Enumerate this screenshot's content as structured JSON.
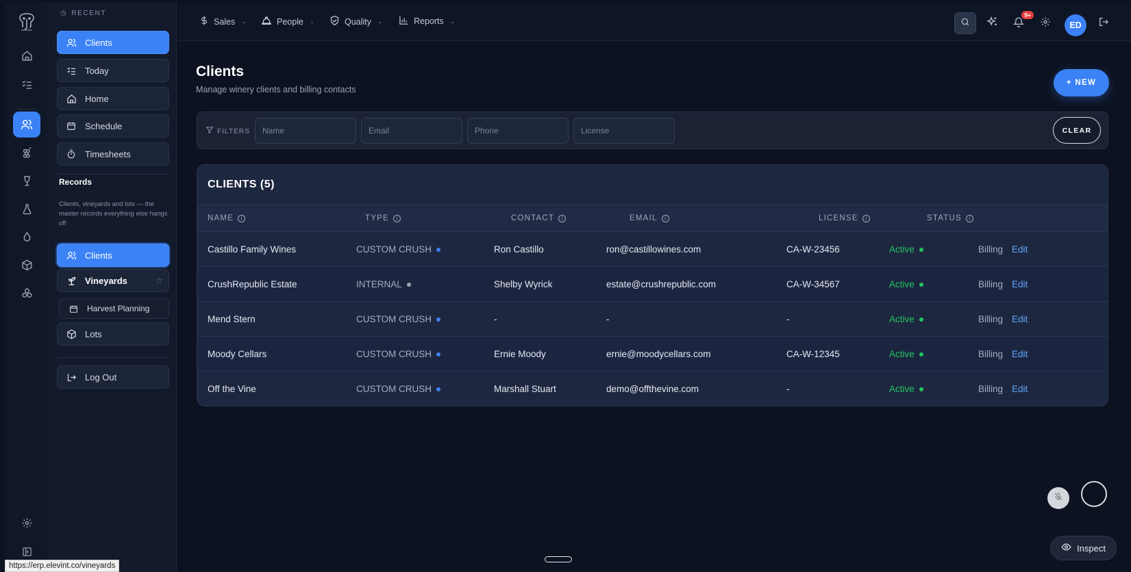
{
  "sidebar": {
    "recent_label": "RECENT",
    "recent_items": [
      {
        "label": "Clients",
        "icon": "users-icon"
      },
      {
        "label": "Today",
        "icon": "checklist-icon"
      },
      {
        "label": "Home",
        "icon": "home-icon"
      },
      {
        "label": "Schedule",
        "icon": "calendar-icon"
      },
      {
        "label": "Timesheets",
        "icon": "stopwatch-icon"
      }
    ],
    "section_title": "Records",
    "section_desc": "Clients, vineyards and lots — the master records everything else hangs off",
    "record_items": [
      {
        "label": "Clients"
      },
      {
        "label": "Vineyards"
      },
      {
        "label": "Harvest Planning"
      },
      {
        "label": "Lots"
      }
    ],
    "logout_label": "Log Out"
  },
  "topnav": [
    {
      "label": "Sales",
      "icon": "dollar-icon"
    },
    {
      "label": "People",
      "icon": "hardhat-icon"
    },
    {
      "label": "Quality",
      "icon": "shield-check-icon"
    },
    {
      "label": "Reports",
      "icon": "bar-chart-icon"
    }
  ],
  "notifications_badge": "9+",
  "avatar_initials": "ED",
  "page": {
    "title": "Clients",
    "subtitle": "Manage winery clients and billing contacts",
    "new_label": "+ NEW"
  },
  "filters": {
    "label": "FILTERS",
    "name_placeholder": "Name",
    "email_placeholder": "Email",
    "phone_placeholder": "Phone",
    "license_placeholder": "License",
    "clear_label": "CLEAR"
  },
  "table": {
    "title": "CLIENTS (5)",
    "columns": [
      "NAME",
      "TYPE",
      "CONTACT",
      "EMAIL",
      "LICENSE",
      "STATUS"
    ],
    "rows": [
      {
        "name": "Castillo Family Wines",
        "type": "CUSTOM CRUSH",
        "type_color": "#3b82f6",
        "contact": "Ron Castillo",
        "email": "ron@castillowines.com",
        "license": "CA-W-23456",
        "status": "Active",
        "billing": "Billing",
        "edit": "Edit"
      },
      {
        "name": "CrushRepublic Estate",
        "type": "INTERNAL",
        "type_color": "#9ca3af",
        "contact": "Shelby Wyrick",
        "email": "estate@crushrepublic.com",
        "license": "CA-W-34567",
        "status": "Active",
        "billing": "Billing",
        "edit": "Edit"
      },
      {
        "name": "Mend Stern",
        "type": "CUSTOM CRUSH",
        "type_color": "#3b82f6",
        "contact": "-",
        "email": "-",
        "license": "-",
        "status": "Active",
        "billing": "Billing",
        "edit": "Edit"
      },
      {
        "name": "Moody Cellars",
        "type": "CUSTOM CRUSH",
        "type_color": "#3b82f6",
        "contact": "Ernie Moody",
        "email": "ernie@moodycellars.com",
        "license": "CA-W-12345",
        "status": "Active",
        "billing": "Billing",
        "edit": "Edit"
      },
      {
        "name": "Off the Vine",
        "type": "CUSTOM CRUSH",
        "type_color": "#3b82f6",
        "contact": "Marshall Stuart",
        "email": "demo@offthevine.com",
        "license": "-",
        "status": "Active",
        "billing": "Billing",
        "edit": "Edit"
      }
    ]
  },
  "inspect_label": "Inspect",
  "status_url": "https://erp.elevint.co/vineyards",
  "colors": {
    "accent": "#3b82f6",
    "active_status": "#22c55e",
    "edit_link": "#60a5fa"
  }
}
